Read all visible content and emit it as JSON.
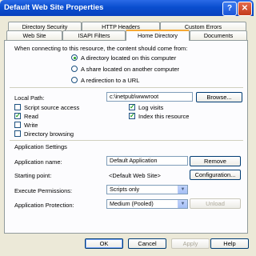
{
  "window": {
    "title": "Default Web Site Properties"
  },
  "tabs_row1": [
    "Directory Security",
    "HTTP Headers",
    "Custom Errors"
  ],
  "tabs_row2": [
    "Web Site",
    "ISAPI Filters",
    "Home Directory",
    "Documents"
  ],
  "active_tab": "Home Directory",
  "content_source": {
    "prompt": "When connecting to this resource, the content should come from:",
    "options": [
      "A directory located on this computer",
      "A share located on another computer",
      "A redirection to a URL"
    ],
    "selected": 0
  },
  "local_path": {
    "label": "Local Path:",
    "value": "c:\\inetpub\\wwwroot",
    "browse": "Browse..."
  },
  "permissions_left": [
    {
      "label": "Script source access",
      "checked": false
    },
    {
      "label": "Read",
      "checked": true
    },
    {
      "label": "Write",
      "checked": false
    },
    {
      "label": "Directory browsing",
      "checked": false
    }
  ],
  "permissions_right": [
    {
      "label": "Log visits",
      "checked": true
    },
    {
      "label": "Index this resource",
      "checked": true
    }
  ],
  "app_settings": {
    "heading": "Application Settings",
    "name_label": "Application name:",
    "name_value": "Default Application",
    "remove": "Remove",
    "start_label": "Starting point:",
    "start_value": "<Default Web Site>",
    "configuration": "Configuration...",
    "exec_label": "Execute Permissions:",
    "exec_value": "Scripts only",
    "protect_label": "Application Protection:",
    "protect_value": "Medium (Pooled)",
    "unload": "Unload"
  },
  "footer": {
    "ok": "OK",
    "cancel": "Cancel",
    "apply": "Apply",
    "help": "Help"
  }
}
